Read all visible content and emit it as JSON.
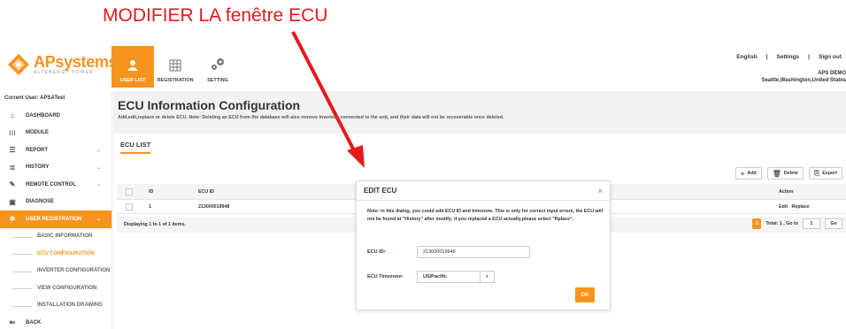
{
  "annotation": {
    "text": "MODIFIER LA fenêtre ECU",
    "color": "#e31b1b"
  },
  "brand": {
    "name": "APsystems",
    "tagline": "ALTENERGY POWER",
    "accent": "#f7941d"
  },
  "nav": {
    "tabs": [
      {
        "label": "USER LIST",
        "icon": "users-icon",
        "active": true
      },
      {
        "label": "REGISTRATION",
        "icon": "grid-icon",
        "active": false
      },
      {
        "label": "SETTING",
        "icon": "gears-icon",
        "active": false
      }
    ]
  },
  "toplinks": {
    "language": "English",
    "settings": "Settings",
    "signout": "Sign out",
    "sep": "|"
  },
  "user": {
    "name": "APS DEMO",
    "location": "Seattle,Washington,United States"
  },
  "sidebar": {
    "current_user": "Current User: APSATest",
    "items": [
      {
        "label": "DASHBOARD",
        "icon": "home-icon"
      },
      {
        "label": "MODULE",
        "icon": "module-icon"
      },
      {
        "label": "REPORT",
        "icon": "report-icon",
        "chevron": "⌄"
      },
      {
        "label": "HISTORY",
        "icon": "history-icon",
        "chevron": "⌄"
      },
      {
        "label": "REMOTE CONTROL",
        "icon": "wrench-icon",
        "chevron": "⌄"
      },
      {
        "label": "DIAGNOSE",
        "icon": "diagnose-icon"
      },
      {
        "label": "USER REGISTRATION",
        "icon": "gears-icon",
        "chevron": "⌄"
      }
    ],
    "subitems": [
      {
        "label": "BASIC INFORMATION"
      },
      {
        "label": "ECU CONFIGURATION"
      },
      {
        "label": "INVERTER CONFIGURATION"
      },
      {
        "label": "VIEW CONFIGURATION"
      },
      {
        "label": "INSTALLATION DRAWING"
      }
    ],
    "back": {
      "label": "BACK",
      "icon": "back-icon"
    }
  },
  "main": {
    "title": "ECU Information Configuration",
    "description": "Add,edit,replace or delete ECU. Note: Deleting an ECU from the database will also remove Inverters connected to the unit, and their data will not be recoverable once deleted.",
    "list_title": "ECU LIST",
    "toolbar": {
      "add": "Add",
      "delete": "Delete",
      "export": "Export"
    },
    "columns": {
      "id": "ID",
      "ecu_id": "ECU ID",
      "action": "Action"
    },
    "rows": [
      {
        "id": "1",
        "ecu_id": "213000019948",
        "edit": "Edit",
        "replace": "Replace"
      }
    ],
    "footer": {
      "displaying": "Displaying 1 to 1 of 1 items.",
      "page": "1",
      "total": "Total: 1 , Go to",
      "goto_value": "1",
      "go": "Go"
    }
  },
  "modal": {
    "title": "EDIT ECU",
    "close": "×",
    "note": "Note: in this dialog, you could edit ECU ID and timezone. This is only for correct input errors, the ECU will not be found at \"History\" after modify; if you replaced a ECU actually,please select \"Rplace\".",
    "ecu_id_label": "ECU ID",
    "ecu_id_value": "213000019948",
    "timezone_label": "ECU Timezone",
    "timezone_value": "US/Pacific",
    "required_mark": "•",
    "ok": "OK"
  }
}
